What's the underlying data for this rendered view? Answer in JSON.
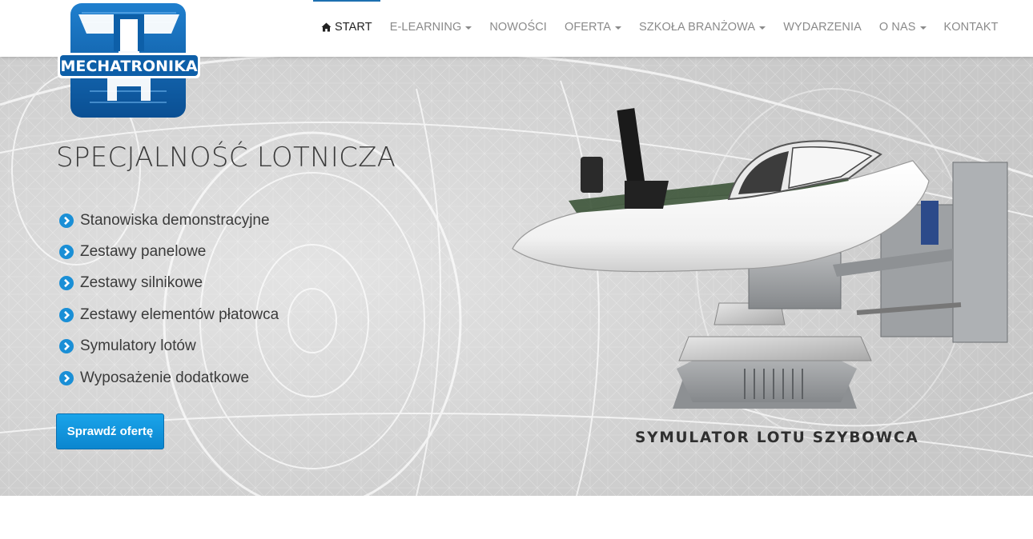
{
  "logo": {
    "text": "MECHATRONIKA"
  },
  "nav": {
    "items": [
      {
        "label": "START",
        "active": true,
        "icon": "home-icon"
      },
      {
        "label": "E-LEARNING",
        "dropdown": true
      },
      {
        "label": "NOWOŚCI"
      },
      {
        "label": "OFERTA",
        "dropdown": true
      },
      {
        "label": "SZKOŁA BRANŻOWA",
        "dropdown": true
      },
      {
        "label": "WYDARZENIA"
      },
      {
        "label": "O NAS",
        "dropdown": true
      },
      {
        "label": "KONTAKT"
      }
    ]
  },
  "hero": {
    "title": "SPECJALNOŚĆ LOTNICZA",
    "features": [
      "Stanowiska demonstracyjne",
      "Zestawy panelowe",
      "Zestawy silnikowe",
      "Zestawy elementów płatowca",
      "Symulatory lotów",
      "Wyposażenie dodatkowe"
    ],
    "cta_label": "Sprawdź ofertę",
    "image_caption": "SYMULATOR LOTU SZYBOWCA"
  },
  "colors": {
    "accent": "#1d6fb0",
    "button": "#0b86cf",
    "bullet": "#1a8fd6",
    "logo_blue": "#0d5fa8"
  }
}
